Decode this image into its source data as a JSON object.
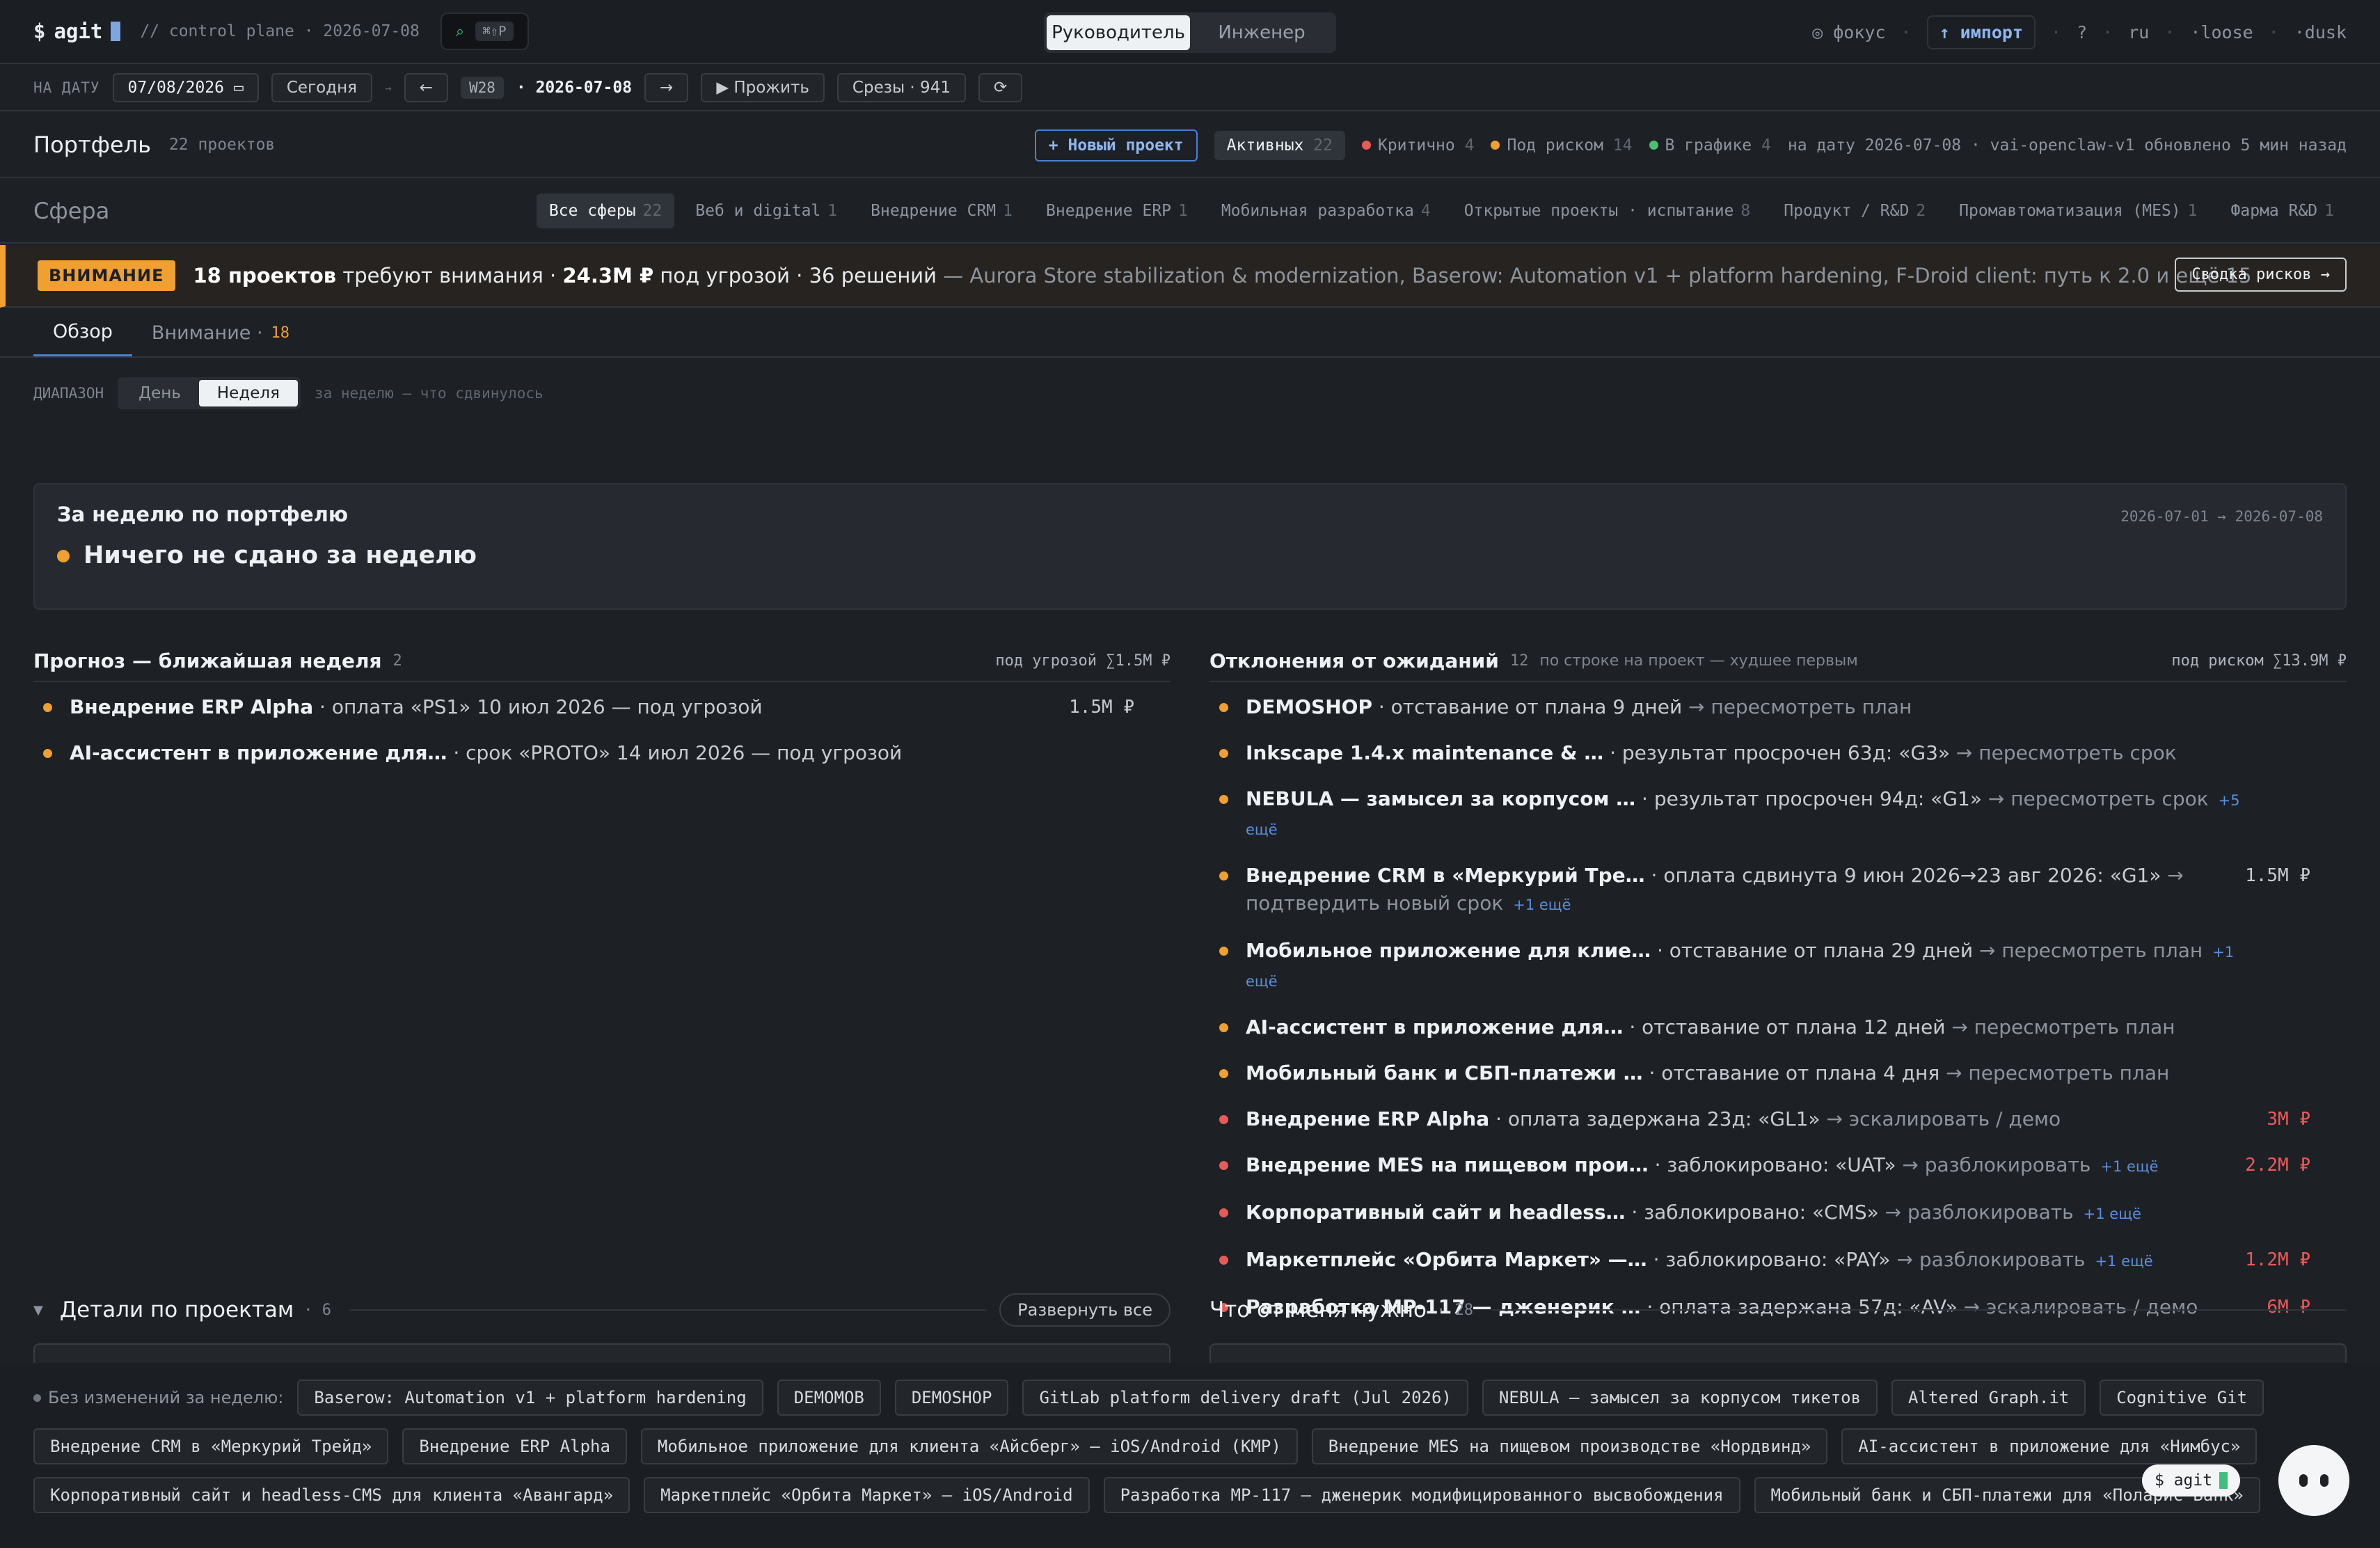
{
  "topbar": {
    "brand_prefix": "$",
    "brand": "agit",
    "context": "// control plane · 2026-07-08",
    "cmdk_shortcut": "⌘⇧P",
    "roles": [
      "Руководитель",
      "Инженер"
    ],
    "active_role": "Руководитель",
    "focus": "◎ фокус",
    "import": "↑ импорт",
    "help": "?",
    "lang": "ru",
    "density": "·loose",
    "theme": "·dusk"
  },
  "datebar": {
    "label": "НА ДАТУ",
    "date_value": "07/08/2026",
    "today": "Сегодня",
    "arrow_sep": "→",
    "prev": "←",
    "week": "W28",
    "current_date": "· 2026-07-08",
    "next": "→",
    "play": "▶ Прожить",
    "slices": "Срезы · 941",
    "refresh": "⟳"
  },
  "portfolio": {
    "title": "Портфель",
    "count": "22 проектов",
    "new_project": "+ Новый проект",
    "active_label": "Активных",
    "active_count": "22",
    "critical_label": "Критично",
    "critical_count": "4",
    "risk_label": "Под риском",
    "risk_count": "14",
    "ontrack_label": "В графике",
    "ontrack_count": "4",
    "status_line": "на дату 2026-07-08 · vai-openclaw-v1 обновлено 5 мин назад"
  },
  "scopes": {
    "title": "Сфера",
    "items": [
      {
        "label": "Все сферы",
        "count": "22"
      },
      {
        "label": "Веб и digital",
        "count": "1"
      },
      {
        "label": "Внедрение CRM",
        "count": "1"
      },
      {
        "label": "Внедрение ERP",
        "count": "1"
      },
      {
        "label": "Мобильная разработка",
        "count": "4"
      },
      {
        "label": "Открытые проекты · испытание",
        "count": "8"
      },
      {
        "label": "Продукт / R&D",
        "count": "2"
      },
      {
        "label": "Промавтоматизация (MES)",
        "count": "1"
      },
      {
        "label": "Фарма R&D",
        "count": "1"
      }
    ]
  },
  "banner": {
    "badge": "ВНИМАНИЕ",
    "projects": "18 проектов",
    "needs": " требуют внимания · ",
    "amount": "24.3M ₽",
    "threat": " под угрозой · 36 решений",
    "rest": " — Aurora Store stabilization & modernization, Baserow: Automation v1 + platform hardening, F-Droid client: путь к 2.0 и ещё 15",
    "risks_button": "Сводка рисков →"
  },
  "tabs": {
    "overview": "Обзор",
    "attention": "Внимание ·",
    "attention_count": "18"
  },
  "range": {
    "label": "ДИАПАЗОН",
    "day": "День",
    "week": "Неделя",
    "hint": "за неделю — что сдвинулось"
  },
  "summary": {
    "title": "За неделю по портфелю",
    "range": "2026-07-01 → 2026-07-08",
    "headline": "Ничего не сдано за неделю"
  },
  "forecast": {
    "title": "Прогноз — ближайшая неделя",
    "count": "2",
    "total": "под угрозой ∑1.5M ₽",
    "items": [
      {
        "name": "Внедрение ERP Alpha",
        "text": " · оплата «PS1» 10 июл 2026 — под угрозой",
        "amount": "1.5M ₽"
      },
      {
        "name": "AI-ассистент в приложение для…",
        "text": " · срок «PROTO» 14 июл 2026 — под угрозой",
        "amount": ""
      }
    ]
  },
  "deviations": {
    "title": "Отклонения от ожиданий",
    "count": "12",
    "subtitle": "по строке на проект — худшее первым",
    "total": "под риском ∑13.9M ₽",
    "items": [
      {
        "name": "DEMOSHOP",
        "text": " · отставание от плана 9 дней",
        "action": " → пересмотреть план",
        "more": "",
        "amount": "",
        "level": "orange"
      },
      {
        "name": "Inkscape 1.4.x maintenance & …",
        "text": " · результат просрочен 63д: «G3»",
        "action": " → пересмотреть срок",
        "more": "",
        "amount": "",
        "level": "orange"
      },
      {
        "name": "NEBULA — замысел за корпусом …",
        "text": " · результат просрочен 94д: «G1»",
        "action": " → пересмотреть срок",
        "more": "+5 ещё",
        "amount": "",
        "level": "orange"
      },
      {
        "name": "Внедрение CRM в «Меркурий Тре…",
        "text": " · оплата сдвинута 9 июн 2026→23 авг 2026: «G1»",
        "action": " → подтвердить новый срок",
        "more": "+1 ещё",
        "amount": "1.5M ₽",
        "level": "orange"
      },
      {
        "name": "Мобильное приложение для клие…",
        "text": " · отставание от плана 29 дней",
        "action": " → пересмотреть план",
        "more": "+1 ещё",
        "amount": "",
        "level": "orange"
      },
      {
        "name": "AI-ассистент в приложение для…",
        "text": " · отставание от плана 12 дней",
        "action": " → пересмотреть план",
        "more": "",
        "amount": "",
        "level": "orange"
      },
      {
        "name": "Мобильный банк и СБП-платежи …",
        "text": " · отставание от плана 4 дня",
        "action": " → пересмотреть план",
        "more": "",
        "amount": "",
        "level": "orange"
      },
      {
        "name": "Внедрение ERP Alpha",
        "text": " · оплата задержана 23д: «GL1»",
        "action": " → эскалировать / демо",
        "more": "",
        "amount": "3M ₽",
        "level": "red"
      },
      {
        "name": "Внедрение MES на пищевом прои…",
        "text": " · заблокировано: «UAT»",
        "action": " → разблокировать",
        "more": "+1 ещё",
        "amount": "2.2M ₽",
        "level": "red"
      },
      {
        "name": "Корпоративный сайт и headless…",
        "text": " · заблокировано: «CMS»",
        "action": " → разблокировать",
        "more": "+1 ещё",
        "amount": "",
        "level": "red"
      },
      {
        "name": "Маркетплейс «Орбита Маркет» —…",
        "text": " · заблокировано: «PAY»",
        "action": " → разблокировать",
        "more": "+1 ещё",
        "amount": "1.2M ₽",
        "level": "red"
      },
      {
        "name": "Разработка МР-117 — дженерик …",
        "text": " · оплата задержана 57д: «AV»",
        "action": " → эскалировать / демо",
        "more": "",
        "amount": "6M ₽",
        "level": "red"
      }
    ]
  },
  "details": {
    "title": "Детали по проектам",
    "count": "· 6",
    "expand": "Развернуть все"
  },
  "needs": {
    "title": "Что от меня нужно",
    "count": "· 28"
  },
  "unchanged": {
    "label": "Без изменений за неделю:",
    "row1": [
      "Baserow: Automation v1 + platform hardening",
      "DEMOMOB",
      "DEMOSHOP",
      "GitLab platform delivery draft (Jul 2026)",
      "NEBULA — замысел за корпусом тикетов",
      "Altered Graph.it",
      "Cognitive Git"
    ],
    "row2": [
      "Внедрение CRM в «Меркурий Трейд»",
      "Внедрение ERP Alpha",
      "Мобильное приложение для клиента «Айсберг» — iOS/Android (KMP)",
      "Внедрение MES на пищевом производстве «Нордвинд»",
      "AI-ассистент в приложение для «Нимбус»"
    ],
    "row3": [
      "Корпоративный сайт и headless-CMS для клиента «Авангард»",
      "Маркетплейс «Орбита Маркет» — iOS/Android",
      "Разработка МР-117 — дженерик модифицированного высвобождения",
      "Мобильный банк и СБП-платежи для «Поларис Банк»"
    ]
  },
  "assistant": {
    "bubble": "$ agit"
  },
  "colors": {
    "accent": "#4a80d0",
    "warning": "#f0a030",
    "critical": "#e85a5a",
    "ok": "#4cc070"
  }
}
